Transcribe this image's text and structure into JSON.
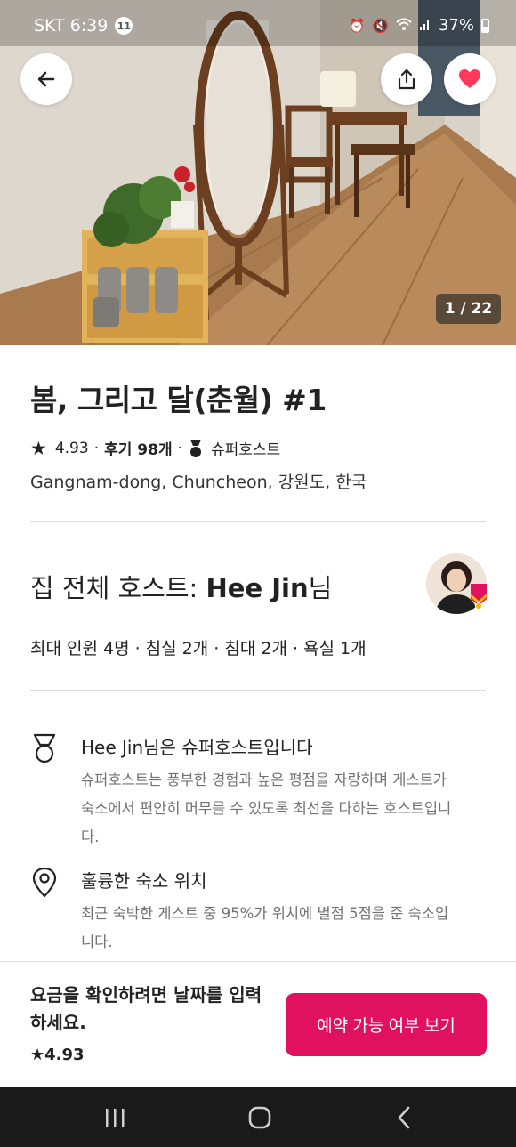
{
  "status_bar": {
    "carrier_time": "SKT 6:39",
    "notification_count": "11",
    "battery": "37%"
  },
  "gallery": {
    "counter": "1 / 22"
  },
  "listing": {
    "title": "봄, 그리고 달(춘월) #1",
    "rating": "4.93",
    "reviews": "후기 98개",
    "superhost_label": "슈퍼호스트",
    "location": "Gangnam-dong, Chuncheon, 강원도, 한국"
  },
  "host": {
    "title_prefix": "집 전체 호스트: ",
    "name": "Hee Jin",
    "suffix": "님"
  },
  "capacity": "최대 인원 4명 · 침실 2개 · 침대 2개 · 욕실 1개",
  "features": [
    {
      "icon": "medal-icon",
      "title": "Hee Jin님은 슈퍼호스트입니다",
      "description": "슈퍼호스트는 풍부한 경험과 높은 평점을 자랑하며 게스트가 숙소에서 편안히 머무를 수 있도록 최선을 다하는 호스트입니다."
    },
    {
      "icon": "location-pin-icon",
      "title": "훌륭한 숙소 위치",
      "description": "최근 숙박한 게스트 중 95%가 위치에 별점 5점을 준 숙소입니다."
    }
  ],
  "bottom_bar": {
    "price_note": "요금을 확인하려면 날짜를 입력하세요.",
    "rating": "4.93",
    "reserve_label": "예약 가능 여부 보기"
  },
  "colors": {
    "brand": "#e0115f",
    "favorite": "#ff385c",
    "text": "#222222",
    "secondary_text": "#717171"
  }
}
